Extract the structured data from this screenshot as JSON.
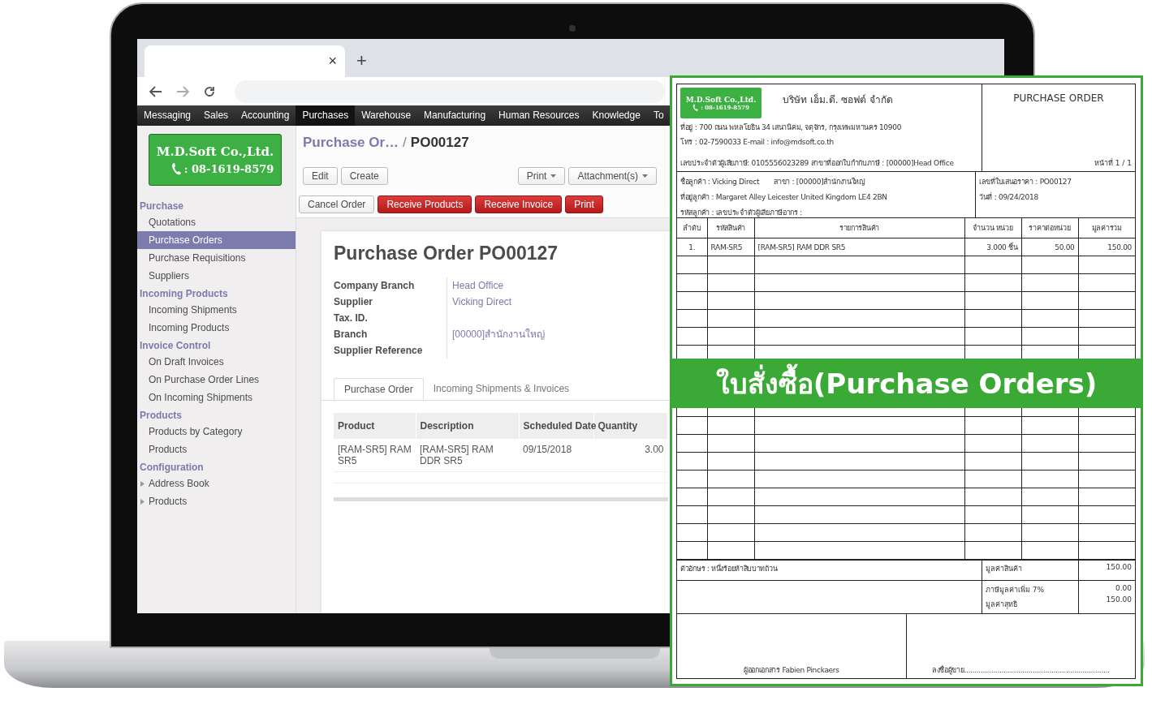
{
  "browser": {
    "tab_close": "×",
    "new_tab": "+"
  },
  "top_menu": [
    {
      "label": "Messaging",
      "selected": false
    },
    {
      "label": "Sales",
      "selected": false
    },
    {
      "label": "Accounting",
      "selected": false
    },
    {
      "label": "Purchases",
      "selected": true
    },
    {
      "label": "Warehouse",
      "selected": false
    },
    {
      "label": "Manufacturing",
      "selected": false
    },
    {
      "label": "Human Resources",
      "selected": false
    },
    {
      "label": "Knowledge",
      "selected": false
    },
    {
      "label": "To",
      "selected": false
    }
  ],
  "sidebar": {
    "logo": {
      "company": "M.D.Soft Co.,Ltd.",
      "phone": ": 08-1619-8579"
    },
    "sections": [
      {
        "title": "Purchase",
        "items": [
          {
            "label": "Quotations",
            "selected": false,
            "expandable": false
          },
          {
            "label": "Purchase Orders",
            "selected": true,
            "expandable": false
          },
          {
            "label": "Purchase Requisitions",
            "selected": false,
            "expandable": false
          },
          {
            "label": "Suppliers",
            "selected": false,
            "expandable": false
          }
        ]
      },
      {
        "title": "Incoming Products",
        "items": [
          {
            "label": "Incoming Shipments",
            "selected": false,
            "expandable": false
          },
          {
            "label": "Incoming Products",
            "selected": false,
            "expandable": false
          }
        ]
      },
      {
        "title": "Invoice Control",
        "items": [
          {
            "label": "On Draft Invoices",
            "selected": false,
            "expandable": false
          },
          {
            "label": "On Purchase Order Lines",
            "selected": false,
            "expandable": false
          },
          {
            "label": "On Incoming Shipments",
            "selected": false,
            "expandable": false
          }
        ]
      },
      {
        "title": "Products",
        "items": [
          {
            "label": "Products by Category",
            "selected": false,
            "expandable": false
          },
          {
            "label": "Products",
            "selected": false,
            "expandable": false
          }
        ]
      },
      {
        "title": "Configuration",
        "items": [
          {
            "label": "Address Book",
            "selected": false,
            "expandable": true
          },
          {
            "label": "Products",
            "selected": false,
            "expandable": true
          }
        ]
      }
    ]
  },
  "breadcrumb": {
    "parent": "Purchase Or…",
    "separator": "/",
    "current": "PO00127"
  },
  "toolbar": {
    "buttons": [
      "Edit",
      "Create"
    ],
    "dropdowns": [
      "Print",
      "Attachment(s)"
    ]
  },
  "status_buttons": [
    {
      "label": "Cancel Order",
      "kind": "default"
    },
    {
      "label": "Receive Products",
      "kind": "primary"
    },
    {
      "label": "Receive Invoice",
      "kind": "primary"
    },
    {
      "label": "Print",
      "kind": "primary"
    }
  ],
  "form": {
    "title": "Purchase Order PO00127",
    "fields": [
      {
        "label": "Company Branch",
        "value": "Head Office"
      },
      {
        "label": "Supplier",
        "value": "Vicking Direct"
      },
      {
        "label": "Tax. ID."
      },
      {
        "label": "Branch",
        "value": "[00000]สำนักงานใหญ่"
      },
      {
        "label": "Supplier Reference"
      }
    ],
    "tabs": [
      {
        "label": "Purchase Order",
        "selected": true
      },
      {
        "label": "Incoming Shipments & Invoices",
        "selected": false
      }
    ],
    "lines": {
      "columns": [
        "Product",
        "Description",
        "Scheduled Date",
        "Quantity"
      ],
      "rows": [
        [
          "[RAM-SR5] RAM SR5",
          "[RAM-SR5] RAM DDR SR5",
          "09/15/2018",
          "3.00"
        ]
      ]
    }
  },
  "document": {
    "logo": {
      "company": "M.D.Soft Co.,Ltd.",
      "phone": ": 08-1619-8579"
    },
    "company_name": "บริษัท เอ็ม.ดี. ซอฟต์ จำกัด",
    "address": "ที่อยู่ :  700   ถนน พหลโยธิน 34 เสนานิคม, จตุจักร, กรุงเทพมหานคร 10900",
    "contact": "โทร : 02-7590033 E-mail : info@mdsoft.co.th",
    "tax": "เลขประจำตัวผู้เสียภาษี: 0105556023289 สาขาที่ออกใบกำกับภาษี : [00000]Head Office",
    "title": "PURCHASE ORDER",
    "page": "หน้าที่ 1 / 1",
    "customer": "ชื่อลูกค้า : Vicking Direct",
    "branch": "สาขา : [00000]สำนักงานใหญ่",
    "customer_address": "ที่อยู่ลูกค้า : Margaret Alley Leicester United Kingdom LE4 2BN",
    "customer_code": "รหัสลูกค้า : เลขประจำตัวผู้เสียภาษีอากร :",
    "number": "เลขที่ใบเสนอราคา : PO00127",
    "date": "วันที่ : 09/24/2018",
    "columns": [
      "ลำดับ",
      "รหัสสินค้า",
      "รายการสินค้า",
      "จำนวน หน่วย",
      "ราคาต่อหน่วย",
      "มูลค่ารวม"
    ],
    "rows": [
      [
        "1.",
        "RAM-SR5",
        "[RAM-SR5] RAM DDR SR5",
        "3.000 ชิ้น",
        "50.00",
        "150.00"
      ]
    ],
    "amount_words": "ตัวอักษร : หนึ่งร้อยห้าสิบบาทถ้วน",
    "totals": [
      {
        "label": "มูลค่าสินค้า",
        "value": "150.00"
      },
      {
        "label": "ภาษีมูลค่าเพิ่ม 7%",
        "value": "0.00"
      },
      {
        "label": "มูลค่าสุทธิ",
        "value": "150.00"
      }
    ],
    "issuer": "ผู้ออกเอกสาร   Fabien Pinckaers",
    "signature": "ลงชื่อผู้ขาย......................................................................"
  },
  "banner": "ใบสั่งซื้อ(Purchase Orders)"
}
